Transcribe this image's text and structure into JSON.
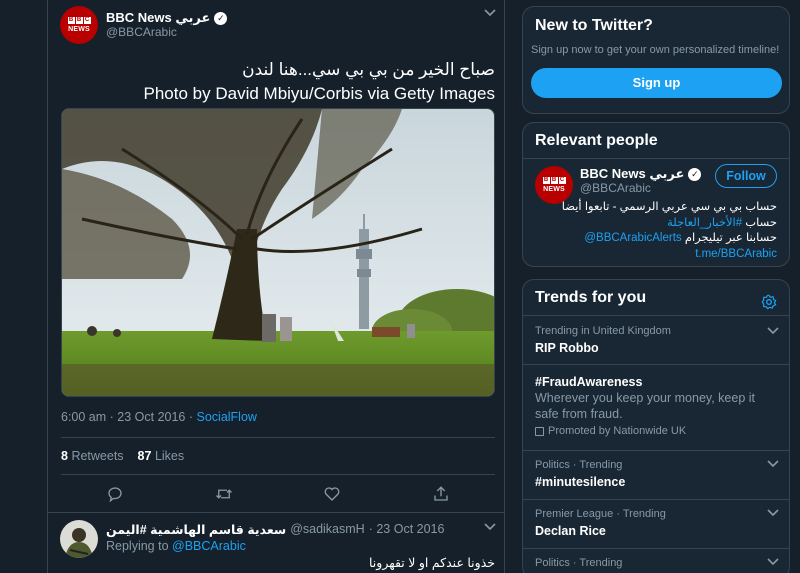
{
  "tweet": {
    "name": "BBC News عربي",
    "handle": "@BBCArabic",
    "avatar_text": "BBC",
    "avatar_subtext": "NEWS",
    "text_line1": "صباح الخير من بي بي سي...هنا لندن",
    "text_line2": "Photo by David Mbiyu/Corbis via Getty Images",
    "time": "6:00 am · 23 Oct 2016 · ",
    "source": "SocialFlow",
    "retweets_count": "8",
    "retweets_label": "Retweets",
    "likes_count": "87",
    "likes_label": "Likes"
  },
  "reply": {
    "name": "سعدية قاسم الهاشمية #اليمن",
    "handle": "@sadikasmH",
    "date": "· 23 Oct 2016",
    "replying_label": "Replying to",
    "replying_to": "@BBCArabic",
    "text": "خذونا عندكم او لا تقهرونا"
  },
  "signup_card": {
    "title": "New to Twitter?",
    "subtitle": "Sign up now to get your own personalized timeline!",
    "button": "Sign up"
  },
  "relevant": {
    "title": "Relevant people",
    "name": "BBC News عربي",
    "handle": "@BBCArabic",
    "follow": "Follow",
    "bio_line1": "حساب بي بي سي عربي الرسمي - تابعوا أيضا",
    "bio_line2_prefix": "حساب ",
    "bio_line2_link": "#الأخبار_العاجلة",
    "bio_line3_text": "حسابنا عبر تيليجرام ",
    "bio_line3_link": "@BBCArabicAlerts",
    "bio_line4": "t.me/BBCArabic"
  },
  "trends": {
    "title": "Trends for you",
    "items": [
      {
        "meta": "Trending in United Kingdom",
        "title": "RIP Robbo"
      },
      {
        "title": "#FraudAwareness",
        "desc": "Wherever you keep your money, keep it safe from fraud.",
        "promo": "Promoted by Nationwide UK"
      },
      {
        "meta": "Politics · Trending",
        "title": "#minutesilence"
      },
      {
        "meta": "Premier League · Trending",
        "title": "Declan Rice"
      },
      {
        "meta": "Politics · Trending",
        "title": ""
      }
    ]
  },
  "colors": {
    "background": "#15202b",
    "card": "#192734",
    "accent": "#1da1f2",
    "muted": "#8899a6",
    "border": "#38444d",
    "bbc_red": "#b80000"
  }
}
